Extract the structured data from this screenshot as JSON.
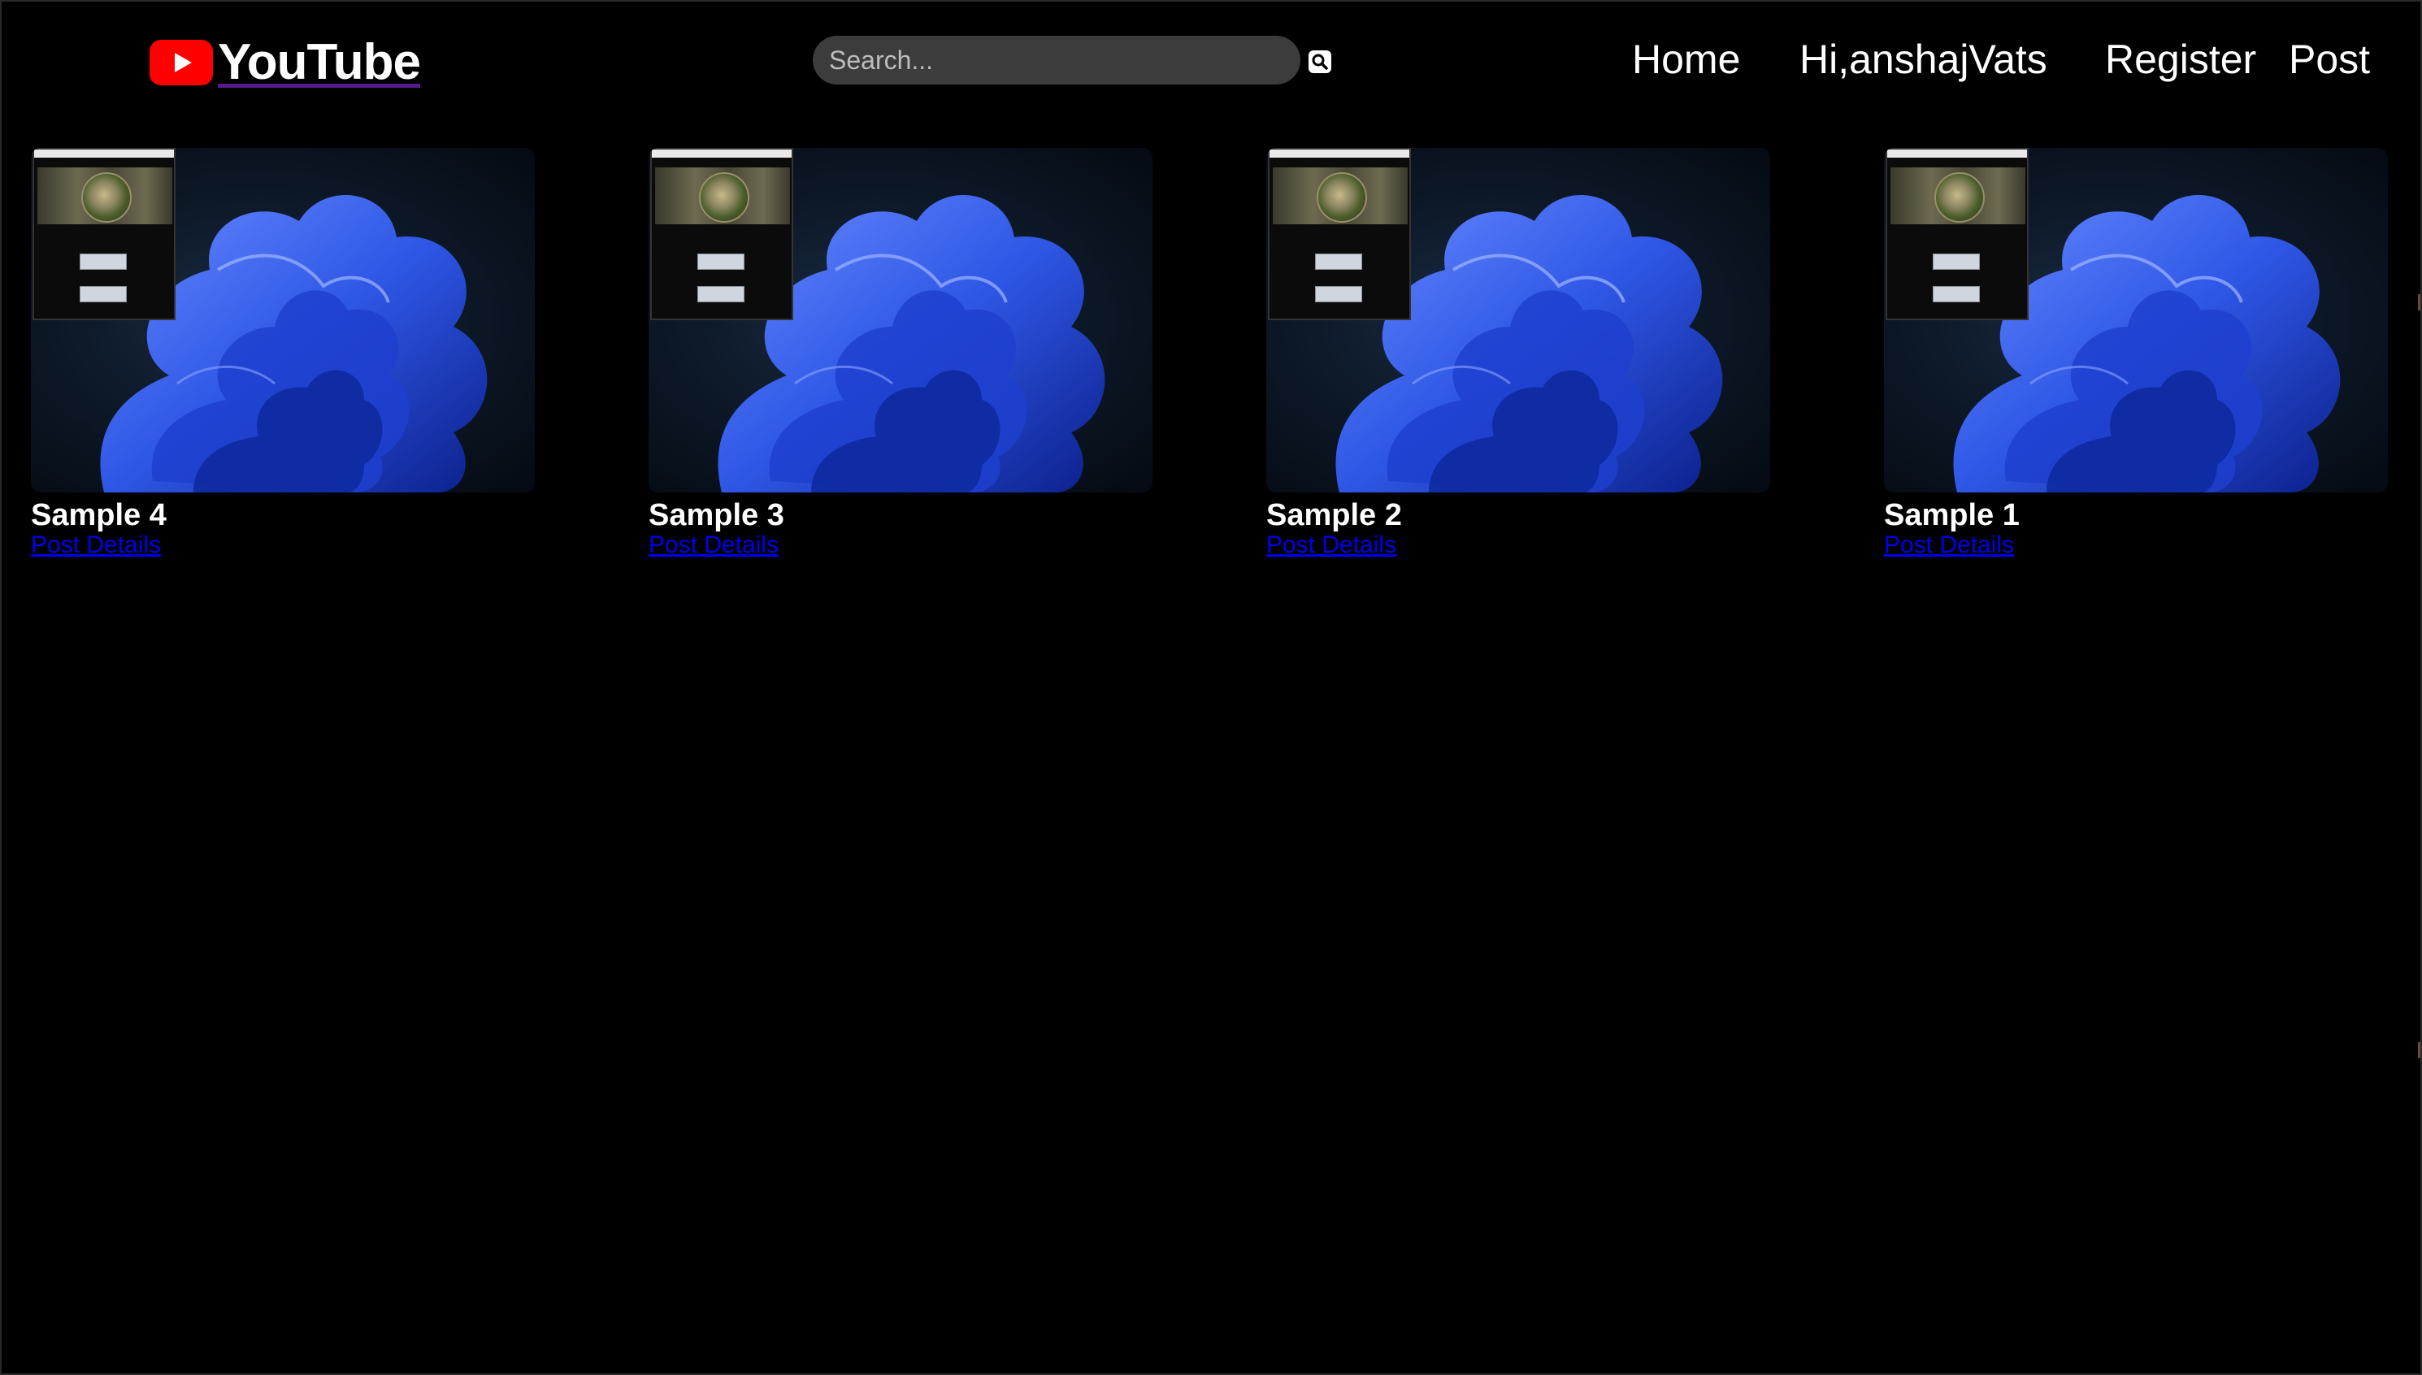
{
  "header": {
    "logo_text": "YouTube",
    "search": {
      "placeholder": "Search...",
      "value": "",
      "icon": "search-icon"
    },
    "nav": [
      {
        "label": "Home"
      },
      {
        "label": "Hi,anshajVats"
      },
      {
        "label": "Register"
      },
      {
        "label": "Post"
      }
    ]
  },
  "posts": [
    {
      "title": "Sample 4",
      "link_label": "Post Details"
    },
    {
      "title": "Sample 3",
      "link_label": "Post Details"
    },
    {
      "title": "Sample 2",
      "link_label": "Post Details"
    },
    {
      "title": "Sample 1",
      "link_label": "Post Details"
    }
  ],
  "colors": {
    "background": "#000000",
    "brand_red": "#ff0000",
    "link_blue": "#0000ee",
    "search_bg": "#3c3c3c",
    "text": "#ffffff"
  }
}
